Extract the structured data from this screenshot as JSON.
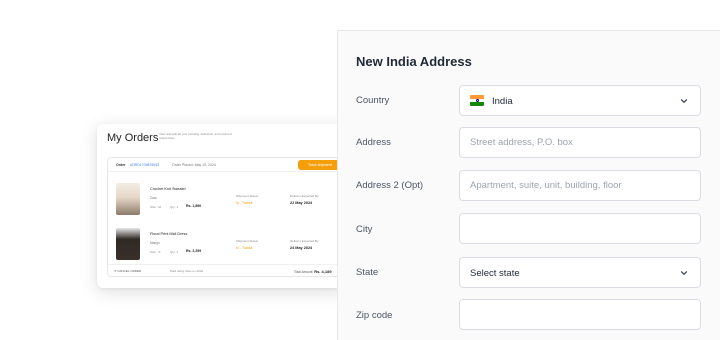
{
  "orders": {
    "title": "My Orders",
    "subtitle": "View and edit all your pending, delivered, and returned orders here.",
    "order_label": "Order",
    "order_id": "#ORD1709876543",
    "placed": "Order Placed: May 10, 2024",
    "track_button": "Track shipment",
    "items": [
      {
        "name": "Crochet Knit Sweater",
        "brand": "Zara",
        "size": "Size : M",
        "qty": "Qty: 1",
        "price": "Rs. 1,890",
        "ship_label": "Shipment Status",
        "ship_status": "In - Transit",
        "deliv_label": "Delivery Expected By",
        "deliv_date": "22 May 2024"
      },
      {
        "name": "Floral Print Midi Dress",
        "brand": "Mango",
        "size": "Size : S",
        "qty": "Qty: 1",
        "price": "Rs. 2,299",
        "ship_label": "Shipment Status",
        "ship_status": "In - Transit",
        "deliv_label": "Delivery Expected By",
        "deliv_date": "24 May 2024"
      }
    ],
    "cancel": "✕  CANCEL ORDER",
    "paid_using": "Paid using Visa •••• 4242",
    "total_label": "Total Amount:",
    "total_value": "Rs. 4,189"
  },
  "form": {
    "title": "New India Address",
    "country_label": "Country",
    "country_value": "India",
    "address_label": "Address",
    "address_placeholder": "Street address, P.O. box",
    "address2_label": "Address 2 (Opt)",
    "address2_placeholder": "Apartment, suite, unit, building, floor",
    "city_label": "City",
    "city_value": "",
    "state_label": "State",
    "state_value": "Select state",
    "zip_label": "Zip code",
    "zip_value": ""
  },
  "icons": {
    "country_flag": "india-flag-icon",
    "dropdown": "chevron-down-icon"
  },
  "colors": {
    "accent": "#f59e0b",
    "link": "#3b82f6",
    "panel_bg": "#fafafa"
  }
}
